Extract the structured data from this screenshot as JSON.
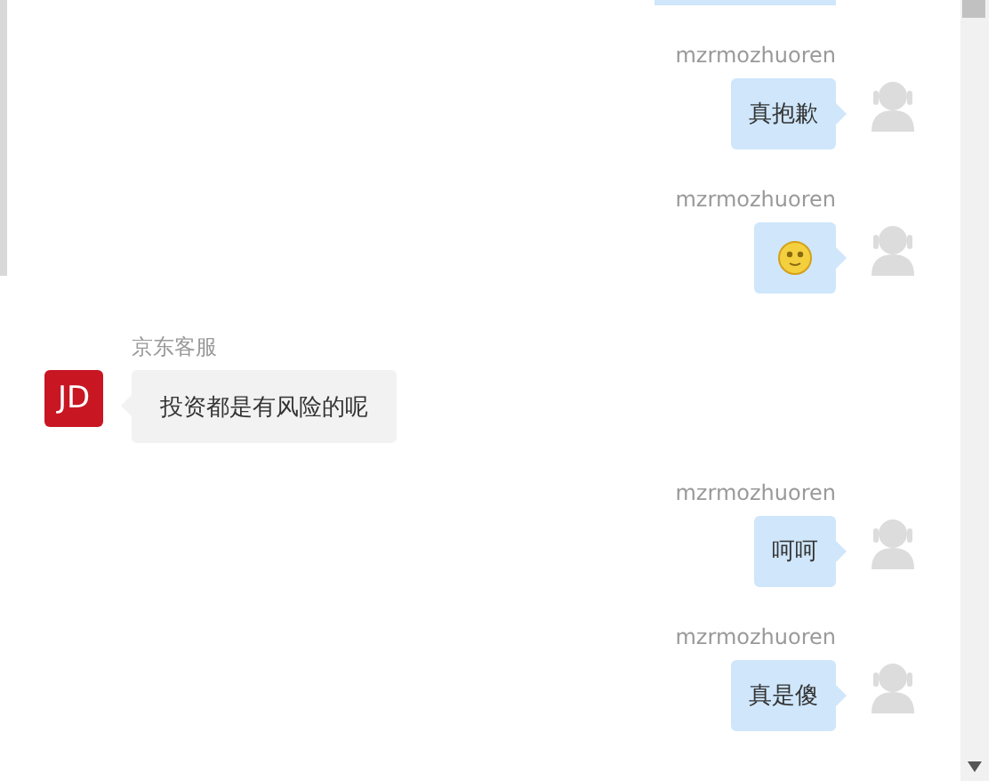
{
  "messages": [
    {
      "outgoing": true,
      "sender": "mzrmozhuoren",
      "kind": "text",
      "text": "真抱歉"
    },
    {
      "outgoing": true,
      "sender": "mzrmozhuoren",
      "kind": "emoji"
    },
    {
      "outgoing": false,
      "sender": "京东客服",
      "avatar": "JD",
      "kind": "text",
      "text": "投资都是有风险的呢"
    },
    {
      "outgoing": true,
      "sender": "mzrmozhuoren",
      "kind": "text",
      "text": "呵呵"
    },
    {
      "outgoing": true,
      "sender": "mzrmozhuoren",
      "kind": "text",
      "text": "真是傻"
    }
  ]
}
